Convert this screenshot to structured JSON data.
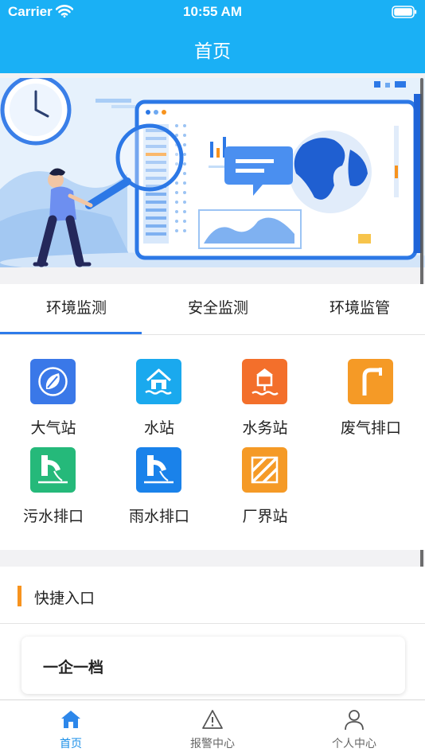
{
  "status_bar": {
    "carrier": "Carrier",
    "time": "10:55 AM"
  },
  "nav": {
    "title": "首页"
  },
  "tabs": [
    {
      "label": "环境监测",
      "active": true
    },
    {
      "label": "安全监测",
      "active": false
    },
    {
      "label": "环境监管",
      "active": false
    }
  ],
  "stations": [
    {
      "label": "大气站",
      "icon": "leaf-icon",
      "color": "#3a78e8"
    },
    {
      "label": "水站",
      "icon": "water-house-icon",
      "color": "#1aa9ee"
    },
    {
      "label": "水务站",
      "icon": "water-affairs-icon",
      "color": "#f36f2b"
    },
    {
      "label": "废气排口",
      "icon": "exhaust-pipe-icon",
      "color": "#f59a26"
    },
    {
      "label": "污水排口",
      "icon": "sewage-outlet-icon",
      "color": "#25b97a"
    },
    {
      "label": "雨水排口",
      "icon": "rain-outlet-icon",
      "color": "#1a82ea"
    },
    {
      "label": "厂界站",
      "icon": "boundary-icon",
      "color": "#f59a26"
    }
  ],
  "quick": {
    "title": "快捷入口",
    "items": [
      {
        "label": "一企一档"
      }
    ]
  },
  "tabbar": [
    {
      "label": "首页",
      "icon": "home-icon",
      "active": true
    },
    {
      "label": "报警中心",
      "icon": "warning-icon",
      "active": false
    },
    {
      "label": "个人中心",
      "icon": "person-icon",
      "active": false
    }
  ],
  "colors": {
    "header": "#1ab0f5",
    "accent": "#2d7bea",
    "quick_bar": "#f7931e"
  }
}
